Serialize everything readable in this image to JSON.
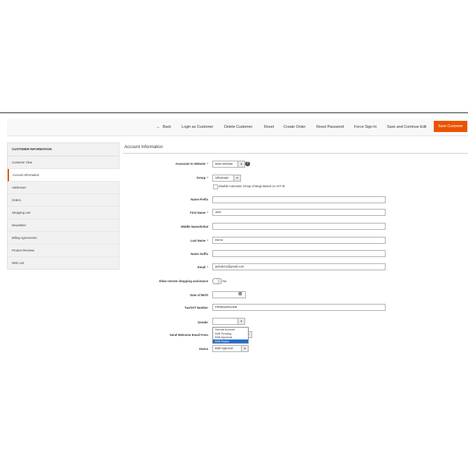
{
  "toolbar": {
    "back": "Back",
    "login": "Login as Customer",
    "delete": "Delete Customer",
    "reset": "Reset",
    "create_order": "Create Order",
    "reset_password": "Reset Password",
    "force_signin": "Force Sign-In",
    "save_continue": "Save and Continue Edit",
    "save": "Save Customer"
  },
  "sidebar": {
    "heading": "Customer Information",
    "items": [
      {
        "label": "Customer View"
      },
      {
        "label": "Account Information"
      },
      {
        "label": "Addresses"
      },
      {
        "label": "Orders"
      },
      {
        "label": "Shopping cart"
      },
      {
        "label": "Newsletter"
      },
      {
        "label": "Billing Agreements"
      },
      {
        "label": "Product Reviews"
      },
      {
        "label": "Wish List"
      }
    ]
  },
  "form": {
    "title": "Account Information",
    "website_label": "Associate to Website",
    "website_value": "Main Website",
    "group_label": "Group",
    "group_value": "Wholesale",
    "disable_group_change": "Disable Automatic Group Change Based on VAT ID",
    "name_prefix_label": "Name Prefix",
    "name_prefix_value": "",
    "first_name_label": "First Name",
    "first_name_value": "Jack",
    "middle_name_label": "Middle Name/Initial",
    "middle_name_value": "",
    "last_name_label": "Last Name",
    "last_name_value": "Demo",
    "name_suffix_label": "Name Suffix",
    "name_suffix_value": "",
    "email_label": "Email",
    "email_value": "jackdemo@gmail.com",
    "remote_assist_label": "Allow remote shopping assistance",
    "remote_assist_value": "No",
    "dob_label": "Date of Birth",
    "dob_value": "",
    "tax_label": "Tax/VAT Number",
    "tax_value": "FR00524001309",
    "gender_label": "Gender",
    "gender_value": "",
    "welcome_email_label": "Send Welcome Email From",
    "status_label": "Status",
    "status_value": "B2B Approval",
    "status_options": [
      "Normal Account",
      "B2B Pending",
      "B2B Approval",
      "B2B Reject"
    ],
    "status_highlighted": "B2B Reject"
  },
  "colors": {
    "accent": "#eb5202",
    "highlight": "#1e6ed8"
  }
}
